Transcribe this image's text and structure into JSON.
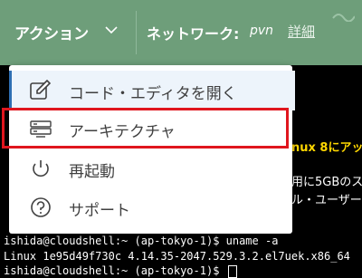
{
  "header": {
    "actions_label": "アクション",
    "network_label": "ネットワーク:",
    "network_value": "pvn",
    "details_link": "詳細"
  },
  "menu": {
    "items": [
      {
        "label": "コード・エディタを開く",
        "icon": "edit-icon"
      },
      {
        "label": "アーキテクチャ",
        "icon": "server-icon"
      },
      {
        "label": "再起動",
        "icon": "restart-icon"
      },
      {
        "label": "サポート",
        "icon": "help-icon"
      }
    ]
  },
  "terminal": {
    "right_fragments": [
      "nux 8にアッ",
      "用に5GBのス",
      "ル・ユーザー"
    ],
    "lines": [
      "ishida@cloudshell:~ (ap-tokyo-1)$ uname -a",
      "Linux 1e95d49f730c 4.14.35-2047.529.3.2.el7uek.x86_64",
      "ishida@cloudshell:~ (ap-tokyo-1)$ "
    ]
  },
  "colors": {
    "topbar": "#6e9e7a",
    "highlight": "#e0161e",
    "editor_accent": "#2f6fb3",
    "terminal_highlight": "#ffd700"
  }
}
